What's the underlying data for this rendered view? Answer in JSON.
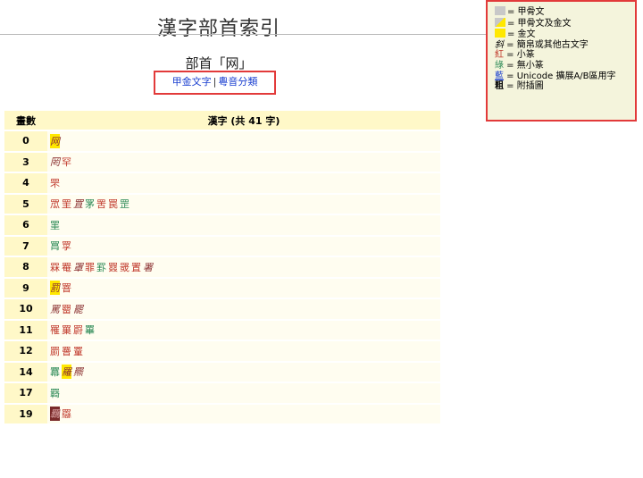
{
  "page": {
    "title": "漢字部首索引"
  },
  "legend": {
    "oracle": "= 甲骨文",
    "oracle_bronze": "= 甲骨文及金文",
    "bronze": "= 金文",
    "bamboo_glyph": "斜",
    "bamboo": " = 簡帛或其他古文字",
    "seal_glyph": "紅",
    "seal": " = 小篆",
    "noseal_glyph": "綠",
    "noseal": " = 無小篆",
    "unicode_glyph": "藍",
    "unicode": " = Unicode 擴展A/B區用字",
    "illus_glyph": "粗",
    "illus": " = 附插圖",
    "colors": {
      "oracle": "#c8c8c8",
      "bronze": "#ffe800",
      "seal": "#c0392b",
      "noseal": "#2e8b57",
      "unicode": "#1a3fd0"
    }
  },
  "radical": {
    "heading": "部首「网」"
  },
  "subnav": {
    "link1": "甲金文字",
    "separator": "|",
    "link2": "粵音分類"
  },
  "table": {
    "header_count": "畫數",
    "header_chars": "漢字 (共 41 字)",
    "rows": [
      {
        "strokes": "0",
        "chars": [
          {
            "t": "网",
            "s": "it gold"
          }
        ]
      },
      {
        "strokes": "3",
        "chars": [
          {
            "t": "罔",
            "s": "it"
          },
          {
            "t": "罕",
            "s": "red"
          }
        ]
      },
      {
        "strokes": "4",
        "chars": [
          {
            "t": "罘",
            "s": "red"
          }
        ]
      },
      {
        "strokes": "5",
        "chars": [
          {
            "t": "罛",
            "s": "red"
          },
          {
            "t": "罜",
            "s": "red"
          },
          {
            "t": "罝",
            "s": "it"
          },
          {
            "t": "罞",
            "s": "green"
          },
          {
            "t": "罟",
            "s": "red"
          },
          {
            "t": "罠",
            "s": "red"
          },
          {
            "t": "罡",
            "s": "green"
          }
        ]
      },
      {
        "strokes": "6",
        "chars": [
          {
            "t": "罣",
            "s": "green"
          }
        ]
      },
      {
        "strokes": "7",
        "chars": [
          {
            "t": "罥",
            "s": "green"
          },
          {
            "t": "罦",
            "s": "red"
          }
        ]
      },
      {
        "strokes": "8",
        "chars": [
          {
            "t": "罧",
            "s": "red"
          },
          {
            "t": "罨",
            "s": "red"
          },
          {
            "t": "罩",
            "s": "it"
          },
          {
            "t": "罪",
            "s": "red"
          },
          {
            "t": "罫",
            "s": "green"
          },
          {
            "t": "罬",
            "s": "red"
          },
          {
            "t": "罭",
            "s": "red"
          },
          {
            "t": "置",
            "s": "red"
          },
          {
            "t": "署",
            "s": "it"
          }
        ]
      },
      {
        "strokes": "9",
        "chars": [
          {
            "t": "罰",
            "s": "it gold"
          },
          {
            "t": "罯",
            "s": "red"
          }
        ]
      },
      {
        "strokes": "10",
        "chars": [
          {
            "t": "罵",
            "s": "it"
          },
          {
            "t": "罶",
            "s": "red"
          },
          {
            "t": "罷",
            "s": "it"
          }
        ]
      },
      {
        "strokes": "11",
        "chars": [
          {
            "t": "罹",
            "s": "red"
          },
          {
            "t": "罺",
            "s": "red"
          },
          {
            "t": "罻",
            "s": "red"
          },
          {
            "t": "罼",
            "s": "green"
          }
        ]
      },
      {
        "strokes": "12",
        "chars": [
          {
            "t": "罽",
            "s": "red"
          },
          {
            "t": "罾",
            "s": "red"
          },
          {
            "t": "罿",
            "s": "red"
          }
        ]
      },
      {
        "strokes": "14",
        "chars": [
          {
            "t": "羃",
            "s": "green"
          },
          {
            "t": "羅",
            "s": "it gold"
          },
          {
            "t": "羆",
            "s": "it"
          }
        ]
      },
      {
        "strokes": "17",
        "chars": [
          {
            "t": "羇",
            "s": "green"
          }
        ]
      },
      {
        "strokes": "19",
        "chars": [
          {
            "t": "羈",
            "s": "it dark"
          },
          {
            "t": "羉",
            "s": "red"
          }
        ]
      }
    ]
  }
}
